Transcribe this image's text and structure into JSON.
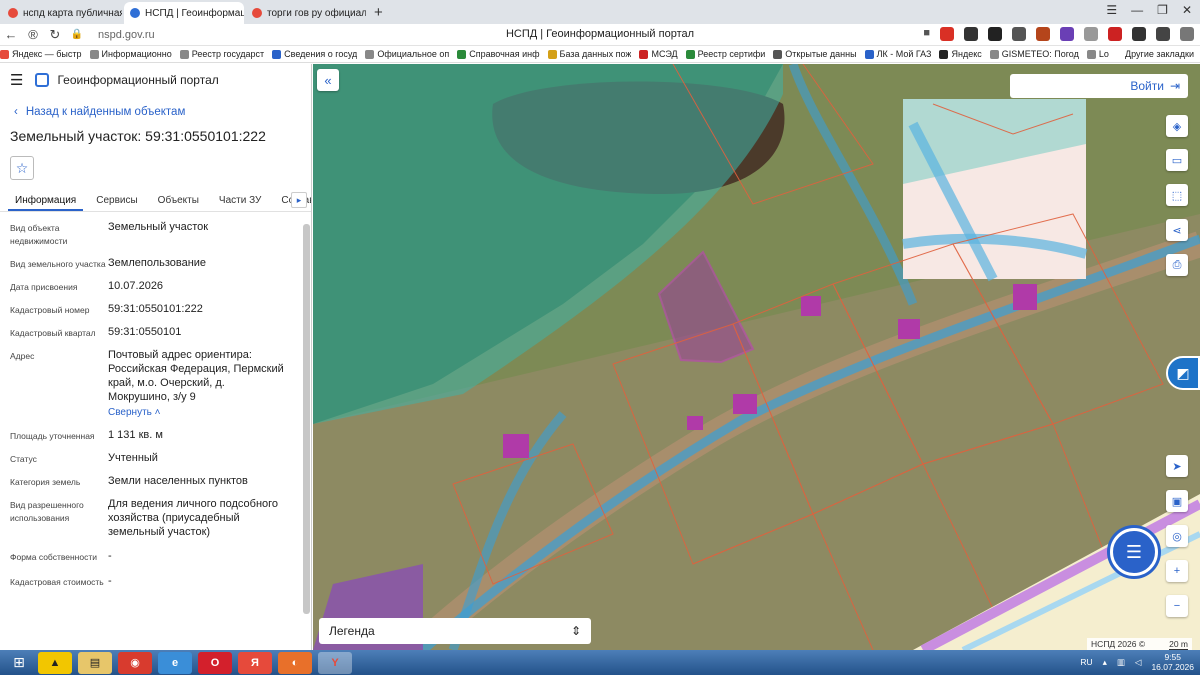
{
  "browser": {
    "tabs": [
      {
        "label": "нспд карта публичная кад",
        "color": "#e64a3b",
        "active": false
      },
      {
        "label": "НСПД | Геоинформацион",
        "color": "#2f6fd6",
        "active": true
      },
      {
        "label": "торги гов ру официальны",
        "color": "#e64a3b",
        "active": false
      }
    ],
    "url": "nspd.gov.ru",
    "page_title": "НСПД | Геоинформационный портал",
    "bookmarks": [
      "Яндекс — быстр",
      "Информационно",
      "Реестр государст",
      "Сведения о госуд",
      "Официальное оп",
      "Справочная инф",
      "База данных пож",
      "МСЭД",
      "Реестр сертифи",
      "Открытые данны",
      "ЛК - Мой ГАЗ",
      "Яндекс",
      "GISMETEO: Погод",
      "Lo"
    ],
    "other_bookmarks": "Другие закладки"
  },
  "sidebar": {
    "app_name": "Геоинформационный портал",
    "back_label": "Назад к найденным объектам",
    "title": "Земельный участок: 59:31:0550101:222",
    "tabs": [
      "Информация",
      "Сервисы",
      "Объекты",
      "Части ЗУ",
      "Состав"
    ],
    "props": [
      {
        "label": "Вид объекта недвижимости",
        "value": "Земельный участок"
      },
      {
        "label": "Вид земельного участка",
        "value": "Землепользование"
      },
      {
        "label": "Дата присвоения",
        "value": "10.07.2026"
      },
      {
        "label": "Кадастровый номер",
        "value": "59:31:0550101:222"
      },
      {
        "label": "Кадастровый квартал",
        "value": "59:31:0550101"
      },
      {
        "label": "Адрес",
        "value": "Почтовый адрес ориентира: Российская Федерация, Пермский край, м.о. Очерский, д. Мокрушино, з/у 9"
      },
      {
        "label": "Площадь уточненная",
        "value": "1 131 кв. м"
      },
      {
        "label": "Статус",
        "value": "Учтенный"
      },
      {
        "label": "Категория земель",
        "value": "Земли населенных пунктов"
      },
      {
        "label": "Вид разрешенного использования",
        "value": "Для ведения личного подсобного хозяйства (приусадебный земельный участок)"
      },
      {
        "label": "Форма собственности",
        "value": "-"
      },
      {
        "label": "Кадастровая стоимость",
        "value": "-"
      }
    ],
    "collapse_label": "Свернуть"
  },
  "map": {
    "login_label": "Войти",
    "legend_label": "Легенда",
    "copyright": "НСПД 2026 ©",
    "scale": "20 m"
  },
  "taskbar": {
    "lang": "RU",
    "time": "9:55",
    "date": "16.07.2026"
  }
}
